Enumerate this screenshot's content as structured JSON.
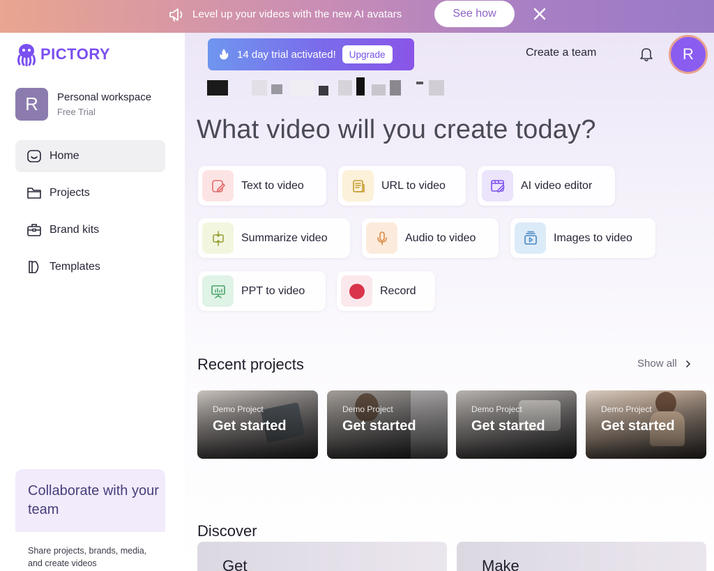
{
  "banner": {
    "icon": "megaphone-icon",
    "text": "Level up your videos with the new AI avatars",
    "cta": "See how",
    "close_icon": "close-icon"
  },
  "sidebar": {
    "logo": "PICTORY",
    "workspace": {
      "initial": "R",
      "name": "Personal workspace",
      "plan": "Free Trial"
    },
    "items": [
      {
        "label": "Home",
        "icon": "home-icon",
        "active": true
      },
      {
        "label": "Projects",
        "icon": "folder-icon",
        "active": false
      },
      {
        "label": "Brand kits",
        "icon": "briefcase-icon",
        "active": false
      },
      {
        "label": "Templates",
        "icon": "templates-icon",
        "active": false
      }
    ],
    "collab": {
      "title": "Collaborate with your team",
      "body": "Share projects, brands, media, and create videos"
    }
  },
  "header": {
    "trial_text": "14 day trial activated!",
    "upgrade": "Upgrade",
    "create_team": "Create a team",
    "avatar_initial": "R"
  },
  "main": {
    "headline": "What video will you create today?",
    "tools": [
      {
        "label": "Text to video",
        "icon": "text-video-icon"
      },
      {
        "label": "URL to video",
        "icon": "url-article-icon"
      },
      {
        "label": "AI video editor",
        "icon": "video-edit-icon"
      },
      {
        "label": "Summarize video",
        "icon": "summarize-icon"
      },
      {
        "label": "Audio to video",
        "icon": "microphone-icon"
      },
      {
        "label": "Images to video",
        "icon": "images-icon"
      },
      {
        "label": "PPT to video",
        "icon": "presentation-icon"
      },
      {
        "label": "Record",
        "icon": "record-icon"
      }
    ],
    "recent_title": "Recent projects",
    "show_all": "Show all",
    "projects": [
      {
        "label": "Demo Project",
        "title": "Get started"
      },
      {
        "label": "Demo Project",
        "title": "Get started"
      },
      {
        "label": "Demo Project",
        "title": "Get started"
      },
      {
        "label": "Demo Project",
        "title": "Get started"
      }
    ],
    "discover_title": "Discover",
    "discover_cards": [
      {
        "title": "Get"
      },
      {
        "title": "Make"
      }
    ]
  },
  "colors": {
    "brand": "#7b4ff0",
    "banner_start": "#e9a58f",
    "banner_end": "#9a7ac7",
    "record_red": "#d9344c"
  }
}
